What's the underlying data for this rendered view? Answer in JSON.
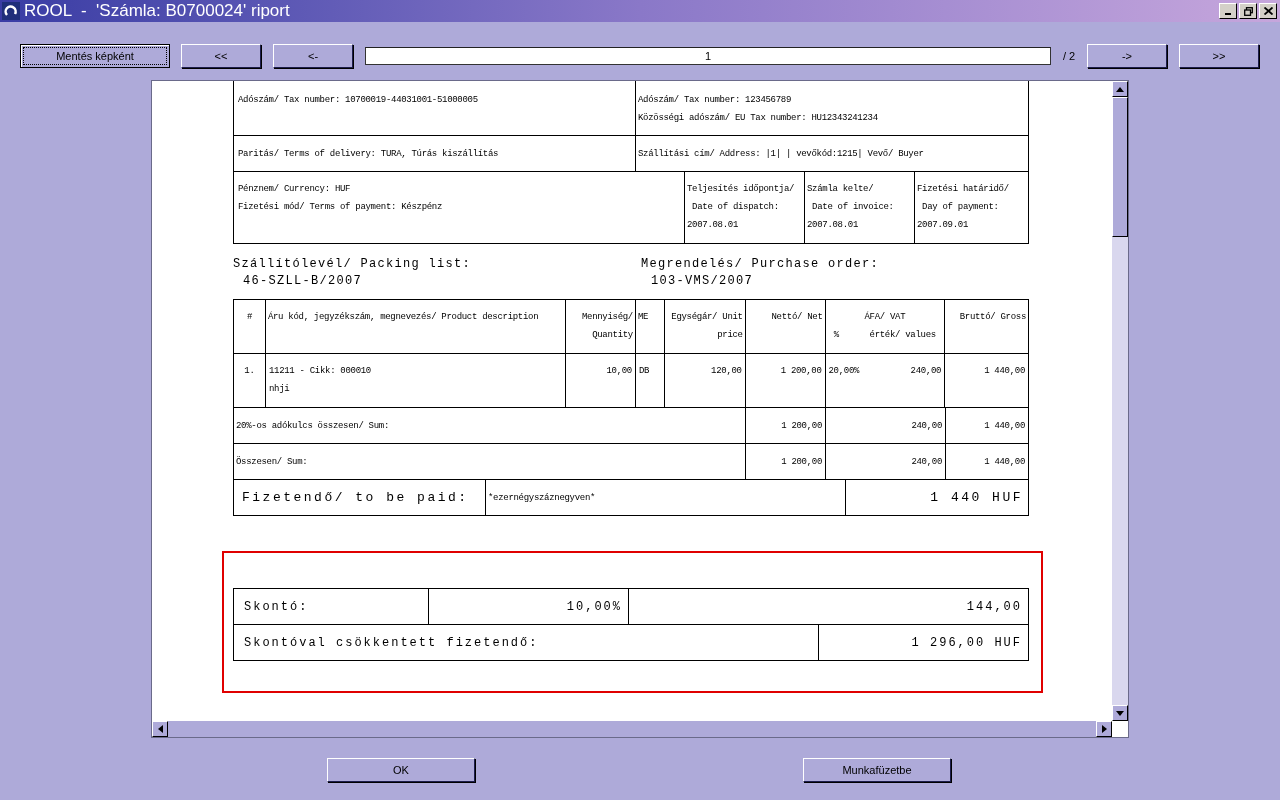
{
  "window": {
    "title": "ROOL  -  'Számla: B0700024' riport"
  },
  "toolbar": {
    "save_button": "Mentés képként",
    "first_button": "<<",
    "prev_button": "<-",
    "page": "1",
    "page_count": "/ 2",
    "next_button": "->",
    "last_button": ">>"
  },
  "header": {
    "seller_tax": "Adószám/ Tax number: 10700019-44031001-51000005",
    "buyer_tax": "Adószám/ Tax number: 123456789",
    "buyer_eu_tax": "Közösségi adószám/ EU Tax number: HU12343241234",
    "delivery_terms": "Paritás/ Terms of delivery: TURA, Túrás kiszállítás",
    "address": "Szállítási cím/ Address: |1| | vevőkód:1215| Vevő/ Buyer",
    "currency": "Pénznem/ Currency: HUF",
    "payment_method": "Fizetési mód/ Terms of payment: Készpénz",
    "dates": [
      {
        "label": "Teljesítés időpontja/",
        "label_en": " Date of dispatch:",
        "value": "2007.08.01"
      },
      {
        "label": "Számla kelte/",
        "label_en": " Date of invoice:",
        "value": "2007.08.01"
      },
      {
        "label": "Fizetési határidő/",
        "label_en": " Day of payment:",
        "value": "2007.09.01"
      }
    ]
  },
  "references": [
    {
      "label": "Szállítólevél/ Packing list:",
      "value": "46-SZLL-B/2007"
    },
    {
      "label": "Megrendelés/ Purchase order:",
      "value": "103-VMS/2007"
    }
  ],
  "items_table": {
    "columns": [
      {
        "lines": [
          "#"
        ]
      },
      {
        "lines": [
          "Áru kód, jegyzékszám, megnevezés/ Product description"
        ]
      },
      {
        "lines": [
          "Mennyiség/",
          "Quantity"
        ]
      },
      {
        "lines": [
          "ME"
        ]
      },
      {
        "lines": [
          "Egységár/ Unit",
          "price"
        ]
      },
      {
        "lines": [
          "Nettó/ Net"
        ]
      },
      {
        "lines": [
          "ÁFA/ VAT",
          "%      érték/ values"
        ]
      },
      {
        "lines": [
          "Bruttó/ Gross"
        ]
      }
    ],
    "rows": [
      {
        "cells": [
          [
            "1."
          ],
          [
            "11211 - Cikk: 000010",
            "nhji"
          ],
          [
            "10,00"
          ],
          [
            "DB"
          ],
          [
            "120,00"
          ],
          [
            "1 200,00"
          ],
          [
            "20,00%",
            "240,00"
          ],
          [
            "1 440,00"
          ]
        ]
      }
    ],
    "sums": [
      {
        "label": "20%-os adókulcs összesen/ Sum:",
        "net": "1 200,00",
        "vat": "240,00",
        "gross": "1 440,00"
      },
      {
        "label": "Összesen/ Sum:",
        "net": "1 200,00",
        "vat": "240,00",
        "gross": "1 440,00"
      }
    ],
    "payable": {
      "label": "Fizetendő/ to be paid:",
      "in_words": "*ezernégyszáznegyven*",
      "amount": "1 440 HUF"
    }
  },
  "discount": {
    "label": "Skontó:",
    "rate": "10,00%",
    "amount": "144,00",
    "reduced_label": "Skontóval csökkentett fizetendő:",
    "reduced_amount": "1 296,00 HUF"
  },
  "buttons": [
    "OK",
    "Munkafüzetbe"
  ]
}
